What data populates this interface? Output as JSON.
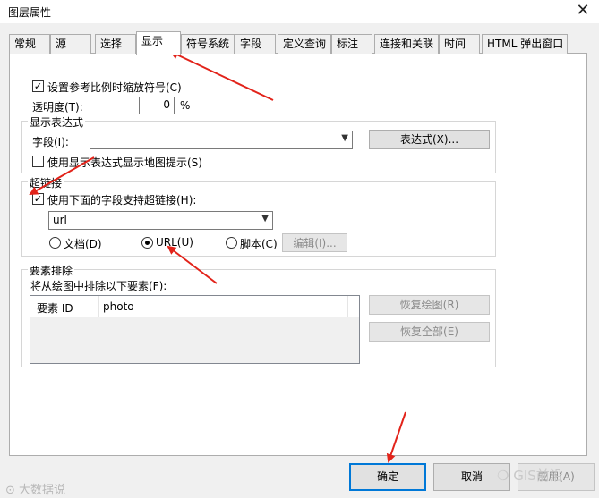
{
  "window": {
    "title": "图层属性",
    "close_glyph": "✕"
  },
  "tabs": [
    {
      "label": "常规"
    },
    {
      "label": "源"
    },
    {
      "label": "选择"
    },
    {
      "label": "显示",
      "active": true
    },
    {
      "label": "符号系统"
    },
    {
      "label": "字段"
    },
    {
      "label": "定义查询"
    },
    {
      "label": "标注"
    },
    {
      "label": "连接和关联"
    },
    {
      "label": "时间"
    },
    {
      "label": "HTML 弹出窗口"
    }
  ],
  "display": {
    "scale_symbols_label": "设置参考比例时缩放符号(C)",
    "scale_symbols_checked": true,
    "transparency_label": "透明度(T):",
    "transparency_value": "0",
    "transparency_unit": "%"
  },
  "expression_group": {
    "title": "显示表达式",
    "field_label": "字段(I):",
    "field_value": "",
    "expression_button": "表达式(X)...",
    "map_tips_label": "使用显示表达式显示地图提示(S)",
    "map_tips_checked": false
  },
  "hyperlink_group": {
    "title": "超链接",
    "use_field_label": "使用下面的字段支持超链接(H):",
    "use_field_checked": true,
    "field_value": "url",
    "options": [
      {
        "label": "文档(D)",
        "selected": false
      },
      {
        "label": "URL(U)",
        "selected": true
      },
      {
        "label": "脚本(C)",
        "selected": false
      }
    ],
    "edit_button": "编辑(I)..."
  },
  "exclusion_group": {
    "title": "要素排除",
    "description": "将从绘图中排除以下要素(F):",
    "columns": [
      "要素 ID",
      "photo"
    ],
    "restore_drawing_button": "恢复绘图(R)",
    "restore_all_button": "恢复全部(E)"
  },
  "footer": {
    "ok_button": "确定",
    "cancel_button": "取消",
    "apply_button": "应用(A)"
  },
  "watermarks": {
    "left": "大数据说",
    "right": "GIS前沿"
  },
  "colors": {
    "annotation_arrow": "#e2231a",
    "primary_border": "#0078d7"
  }
}
